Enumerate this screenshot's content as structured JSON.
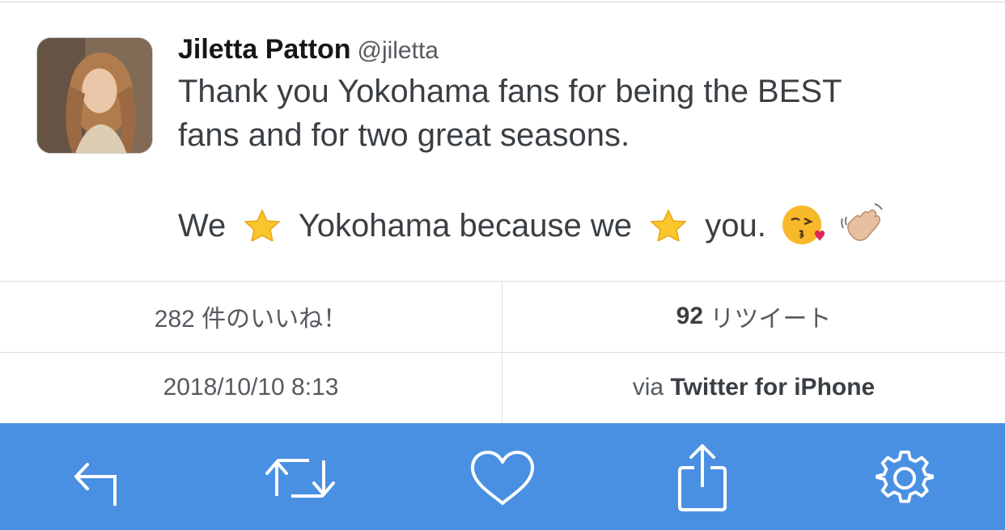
{
  "tweet": {
    "author_name": "Jiletta Patton",
    "author_handle": "@jiletta",
    "line1": "Thank you Yokohama fans for being the BEST",
    "line2": "fans and for two great seasons.",
    "line3_part1": "We",
    "line3_part2": "Yokohama because we",
    "line3_part3": "you.",
    "icons": [
      "star-icon",
      "star-icon",
      "kissing-face-icon",
      "waving-hand-icon"
    ]
  },
  "stats": {
    "likes_label": "282 件のいいね！",
    "retweets_count": "92",
    "retweets_label": "リツイート"
  },
  "meta": {
    "timestamp": "2018/10/10 8:13",
    "via_label": "via",
    "source": "Twitter for iPhone"
  },
  "toolbar": {
    "items": [
      "reply-icon",
      "retweet-icon",
      "like-icon",
      "share-icon",
      "settings-icon"
    ]
  },
  "colors": {
    "toolbar_bg": "#4a90e2",
    "icon": "#ffffff",
    "star": "#f9c62b"
  }
}
